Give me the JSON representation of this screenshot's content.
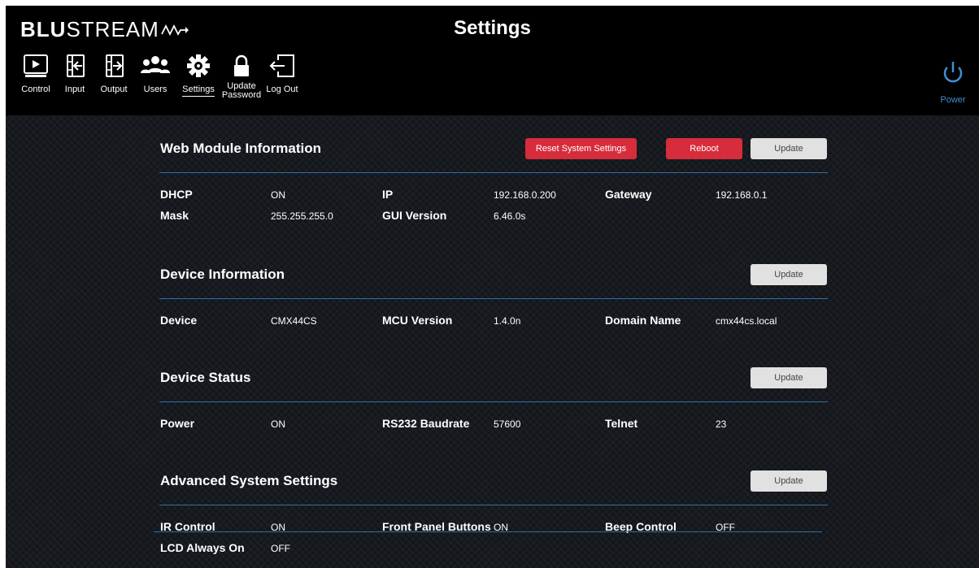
{
  "header": {
    "logo_bold": "BLU",
    "logo_light": "STREAM",
    "title": "Settings"
  },
  "nav": [
    {
      "label": "Control",
      "icon": "control-icon"
    },
    {
      "label": "Input",
      "icon": "input-icon"
    },
    {
      "label": "Output",
      "icon": "output-icon"
    },
    {
      "label": "Users",
      "icon": "users-icon"
    },
    {
      "label": "Settings",
      "icon": "gear-icon",
      "active": true
    },
    {
      "label": "Update Password",
      "icon": "lock-icon"
    },
    {
      "label": "Log Out",
      "icon": "logout-icon"
    }
  ],
  "power": {
    "label": "Power",
    "icon": "power-icon",
    "color": "#3f8fd6"
  },
  "colors": {
    "accent_red": "#d62c3c",
    "divider_blue": "#2f6fa8",
    "header_bg": "#000000"
  },
  "sections": {
    "web_module": {
      "title": "Web Module Information",
      "reset_label": "Reset System Settings",
      "reboot_label": "Reboot",
      "update_label": "Update",
      "dhcp_label": "DHCP",
      "dhcp_value": "ON",
      "ip_label": "IP",
      "ip_value": "192.168.0.200",
      "gateway_label": "Gateway",
      "gateway_value": "192.168.0.1",
      "mask_label": "Mask",
      "mask_value": "255.255.255.0",
      "gui_label": "GUI Version",
      "gui_value": "6.46.0s"
    },
    "device_info": {
      "title": "Device Information",
      "update_label": "Update",
      "device_label": "Device",
      "device_value": "CMX44CS",
      "mcu_label": "MCU Version",
      "mcu_value": "1.4.0n",
      "domain_label": "Domain Name",
      "domain_value": "cmx44cs.local"
    },
    "device_status": {
      "title": "Device Status",
      "update_label": "Update",
      "power_label": "Power",
      "power_value": "ON",
      "baud_label": "RS232 Baudrate",
      "baud_value": "57600",
      "telnet_label": "Telnet",
      "telnet_value": "23"
    },
    "advanced": {
      "title": "Advanced System Settings",
      "update_label": "Update",
      "ir_label": "IR Control",
      "ir_value": "ON",
      "fp_label": "Front Panel Buttons",
      "fp_value": "ON",
      "beep_label": "Beep Control",
      "beep_value": "OFF",
      "lcd_label": "LCD Always On",
      "lcd_value": "OFF"
    }
  }
}
